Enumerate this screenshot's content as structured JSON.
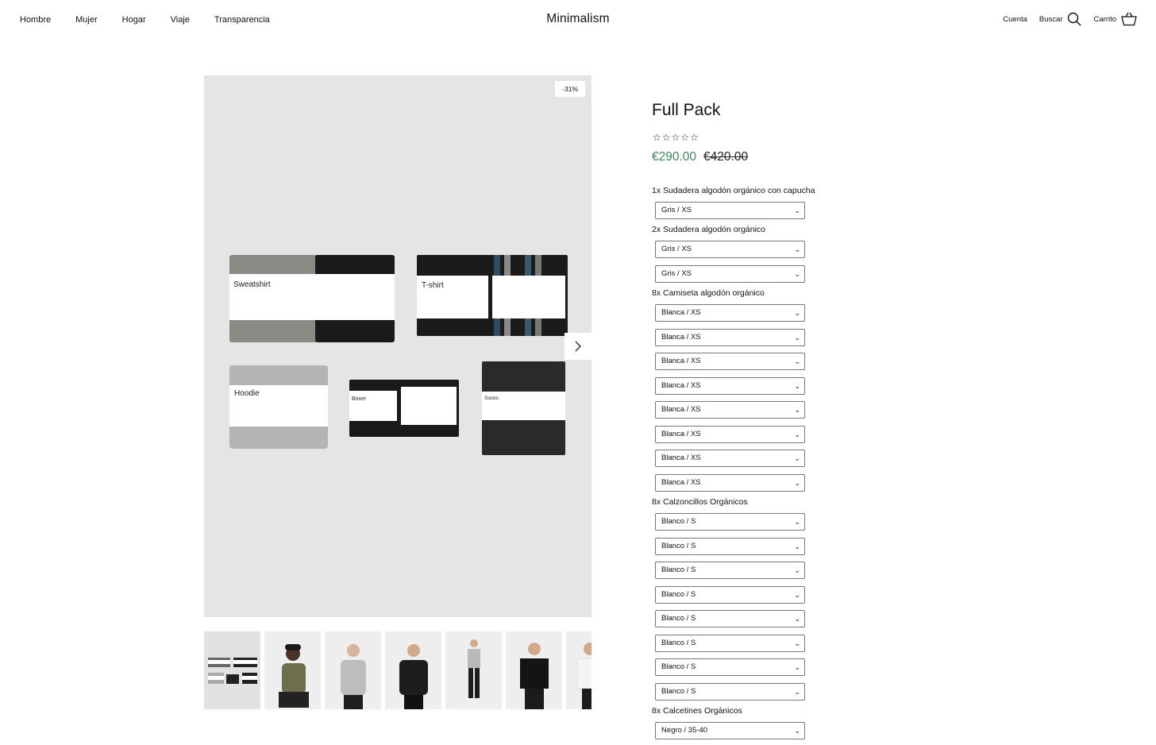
{
  "nav": {
    "left": [
      "Hombre",
      "Mujer",
      "Hogar",
      "Viaje",
      "Transparencia"
    ],
    "brand": "Minimalism",
    "account": "Cuenta",
    "search": "Buscar",
    "cart": "Carrito"
  },
  "gallery": {
    "discount_badge": "-31%",
    "product_labels": [
      "Sweatshirt",
      "T-shirt",
      "Hoodie",
      "Boxer",
      "Socks"
    ]
  },
  "product": {
    "title": "Full Pack",
    "rating_stars": "☆☆☆☆☆",
    "price": "€290.00",
    "original_price": "€420.00"
  },
  "option_groups": [
    {
      "label": "1x Sudadera algodón orgánico con capucha",
      "values": [
        "Gris / XS"
      ]
    },
    {
      "label": "2x Sudadera algodón orgánico",
      "values": [
        "Gris / XS",
        "Gris / XS"
      ]
    },
    {
      "label": "8x Camiseta algodón orgánico",
      "values": [
        "Blanca / XS",
        "Blanca / XS",
        "Blanca / XS",
        "Blanca / XS",
        "Blanca / XS",
        "Blanca / XS",
        "Blanca / XS",
        "Blanca / XS"
      ]
    },
    {
      "label": "8x Calzoncillos Orgánicos",
      "values": [
        "Blanco / S",
        "Blanco / S",
        "Blanco / S",
        "Blanco / S",
        "Blanco / S",
        "Blanco / S",
        "Blanco / S",
        "Blanco / S"
      ]
    },
    {
      "label": "8x Calcetines Orgánicos",
      "values": [
        "Negro / 35-40"
      ]
    }
  ],
  "colors": {
    "sale_price": "#3d8a5e",
    "image_bg": "#e5e5e5"
  }
}
